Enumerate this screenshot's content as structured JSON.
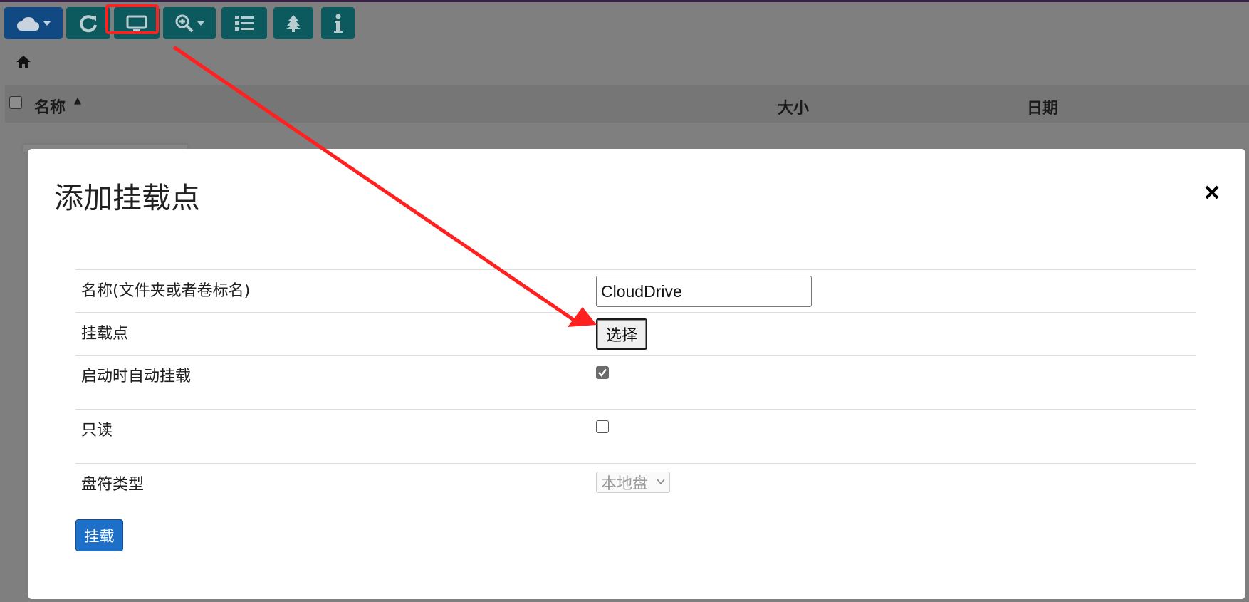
{
  "table_header": {
    "name_label": "名称",
    "size_label": "大小",
    "date_label": "日期"
  },
  "toolbar": {
    "icons": [
      "cloud-icon",
      "refresh-icon",
      "monitor-icon",
      "zoom-in-icon",
      "list-icon",
      "tree-icon",
      "info-icon"
    ]
  },
  "modal": {
    "title": "添加挂载点",
    "fields": [
      {
        "label": "名称(文件夹或者卷标名)",
        "value": "CloudDrive"
      },
      {
        "label": "挂载点",
        "button_label": "选择"
      },
      {
        "label": "启动时自动挂载",
        "checked": true
      },
      {
        "label": "只读",
        "checked": false
      },
      {
        "label": "盘符类型",
        "selected": "本地盘"
      }
    ],
    "submit_label": "挂载"
  },
  "colors": {
    "overlay": "#7f7f7f",
    "toolbar_teal": "#0c5a5e",
    "toolbar_blue": "#114a83",
    "primary_button": "#1e6fc7",
    "annotation_red": "#ff2020"
  }
}
